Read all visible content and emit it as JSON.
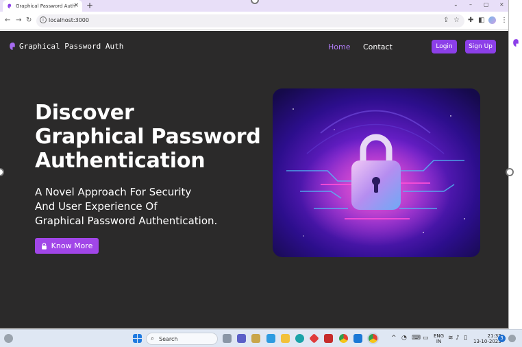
{
  "browser": {
    "tab_title": "Graphical Password Auth",
    "tab_close": "×",
    "new_tab": "+",
    "url": "localhost:3000",
    "window_controls": {
      "dropdown": "⌄",
      "minimize": "–",
      "maximize": "▢",
      "close": "×"
    },
    "nav": {
      "back": "←",
      "forward": "→",
      "reload": "↻"
    },
    "address_icons": {
      "info": "i",
      "share": "⇪",
      "star": "☆"
    },
    "toolbar_icons": {
      "extensions": "✚",
      "sidepanel": "◧",
      "menu": "⋮"
    }
  },
  "site": {
    "brand": "Graphical Password Auth",
    "nav": {
      "home": "Home",
      "contact": "Contact"
    },
    "login_label": "Login",
    "signup_label": "Sign Up",
    "headline": [
      "Discover",
      "Graphical Password",
      "Authentication"
    ],
    "subheadline": [
      "A Novel Approach For Security",
      "And User Experience Of",
      "Graphical Password Authentication."
    ],
    "cta_label": "Know More",
    "colors": {
      "accent": "#8c3fe8",
      "background": "#2b2a2a",
      "nav_active": "#b07cf5"
    }
  },
  "taskbar": {
    "search_placeholder": "Search",
    "lang_top": "ENG",
    "lang_bottom": "IN",
    "time": "21:32",
    "date": "13-10-2023",
    "notification_count": "3",
    "overflow": "^"
  },
  "icons": [
    "favicon-icon",
    "info-icon",
    "share-icon",
    "star-icon",
    "extensions-icon",
    "sidepanel-icon",
    "profile-icon",
    "menu-icon",
    "lock-icon",
    "windows-start-icon",
    "search-icon",
    "wifi-icon",
    "volume-icon",
    "battery-icon"
  ]
}
